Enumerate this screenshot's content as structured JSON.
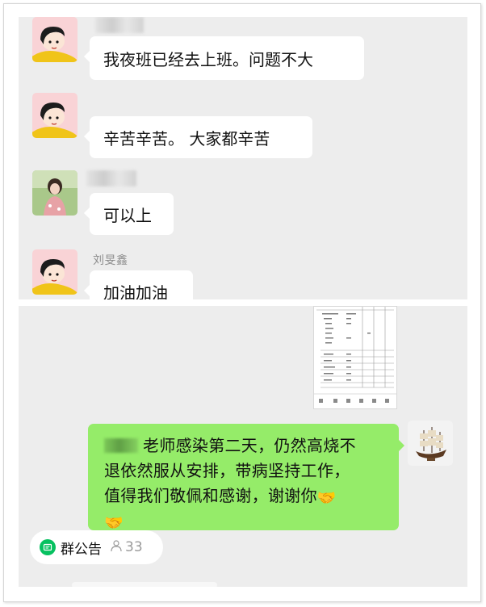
{
  "top_chat": {
    "messages": [
      {
        "sender": "",
        "text": "我夜班已经去上班。问题不大"
      },
      {
        "sender": "",
        "text": "辛苦辛苦。 大家都辛苦"
      },
      {
        "sender": "",
        "text": "可以上"
      },
      {
        "sender": "刘旻鑫",
        "text": "加油加油"
      }
    ]
  },
  "bottom_chat": {
    "green_message": {
      "lines": [
        "老师感染第二天，仍然高烧不",
        "退依然服从安排，带病坚持工作，",
        "值得我们敬佩和感谢，谢谢你"
      ],
      "emoji_icon": "handshake-emoji"
    },
    "attachment_icon": "spreadsheet-thumbnail",
    "announcement": {
      "label": "群公告",
      "count": "33",
      "icon": "announcement-icon",
      "people_icon": "person-icon"
    }
  },
  "colors": {
    "chat_bg": "#ededed",
    "bubble_white": "#ffffff",
    "bubble_green": "#95ec69",
    "wechat_green": "#07c160",
    "name_gray": "#8e8e8e"
  }
}
